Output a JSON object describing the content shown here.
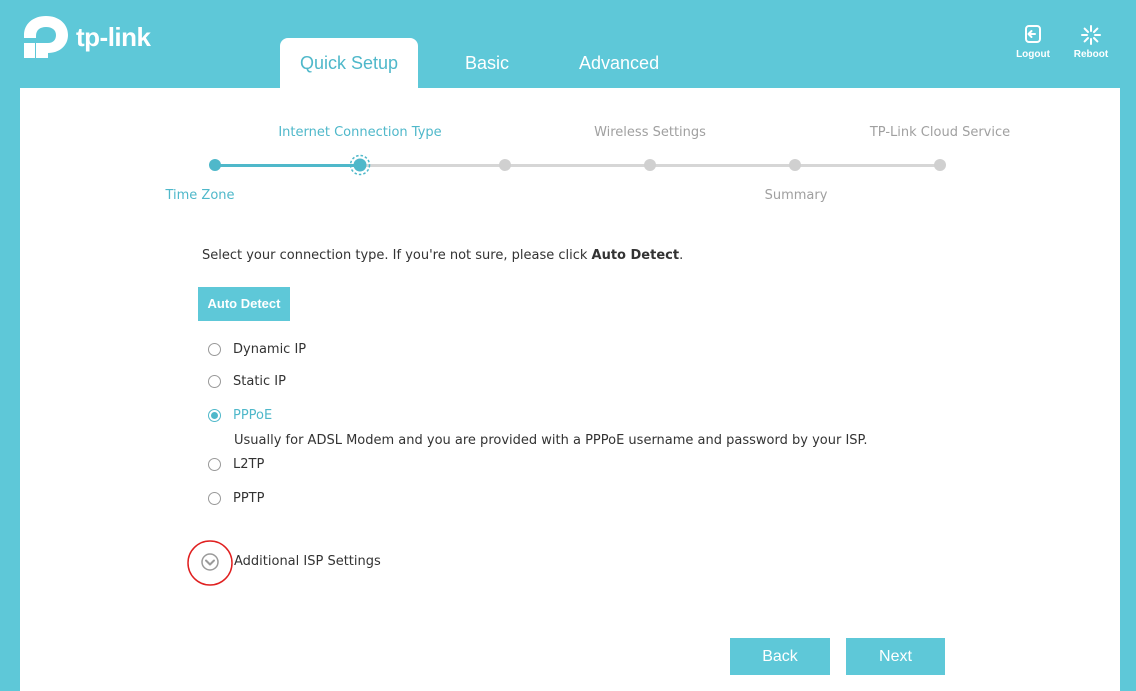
{
  "brand": {
    "name": "tp-link",
    "logo_icon": "tp-link-logo-icon",
    "accent_color": "#5ec8d8"
  },
  "tabs": [
    {
      "label": "Quick Setup",
      "active": true
    },
    {
      "label": "Basic",
      "active": false
    },
    {
      "label": "Advanced",
      "active": false
    }
  ],
  "header_buttons": {
    "logout": {
      "label": "Logout",
      "icon": "logout-icon"
    },
    "reboot": {
      "label": "Reboot",
      "icon": "reboot-icon"
    }
  },
  "stepper": {
    "steps": [
      {
        "label": "Time Zone",
        "state": "done"
      },
      {
        "label": "Internet Connection Type",
        "state": "current"
      },
      {
        "label": "Wireless Settings",
        "state": "pending"
      },
      {
        "label": "Summary",
        "state": "pending"
      },
      {
        "label": "TP-Link Cloud Service",
        "state": "pending"
      }
    ]
  },
  "instruction": {
    "text": "Select your connection type. If you're not sure, please click ",
    "bold": "Auto Detect",
    "end": "."
  },
  "auto_detect_label": "Auto Detect",
  "connection_types": [
    {
      "label": "Dynamic IP",
      "checked": false
    },
    {
      "label": "Static IP",
      "checked": false
    },
    {
      "label": "PPPoE",
      "checked": true
    },
    {
      "label": "L2TP",
      "checked": false
    },
    {
      "label": "PPTP",
      "checked": false
    }
  ],
  "pppoe_hint": "Usually for ADSL Modem and you are provided with a PPPoE username and password by your ISP.",
  "additional_isp": {
    "label": "Additional ISP Settings",
    "icon": "chevron-down-circle-icon",
    "highlight_color": "#e02020"
  },
  "footer": {
    "back_label": "Back",
    "next_label": "Next"
  }
}
